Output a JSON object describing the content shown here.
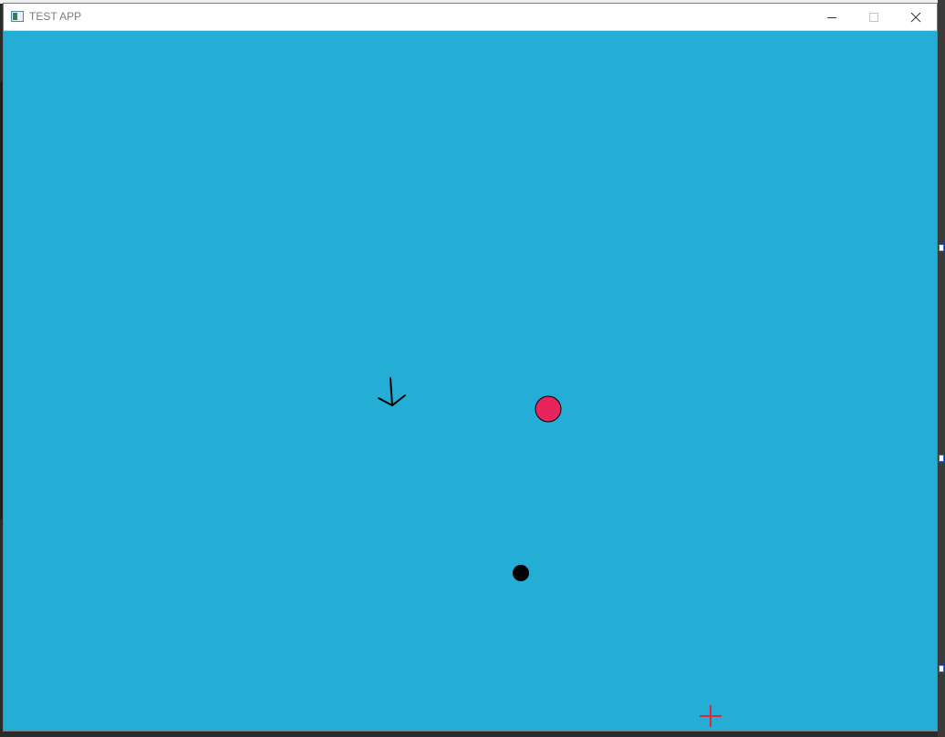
{
  "window": {
    "title": "TEST APP"
  },
  "titlebar_buttons": {
    "minimize_icon": "minimize-icon",
    "maximize_icon": "maximize-icon",
    "close_icon": "close-icon"
  },
  "game": {
    "background_color": "#24aed6",
    "player_ship": {
      "icon": "arrow-down-icon",
      "color": "#000000"
    },
    "enemy_ball": {
      "icon": "pink-circle",
      "color": "#e8245c",
      "outline": "#000000"
    },
    "projectile": {
      "icon": "black-dot",
      "color": "#000000"
    },
    "crosshair": {
      "icon": "crosshair-icon",
      "color": "#e8243a"
    }
  }
}
